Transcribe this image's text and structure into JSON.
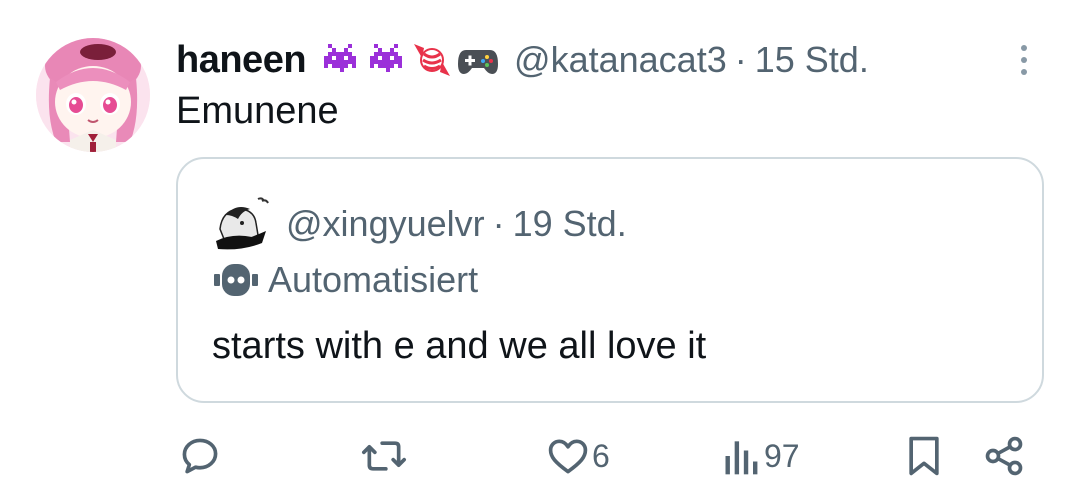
{
  "post": {
    "author": {
      "display_name": "haneen",
      "emoji_icons": [
        "purple-invader-icon",
        "purple-invader-icon",
        "candy-icon",
        "game-controller-icon"
      ],
      "handle": "@katanacat3",
      "separator": "·",
      "timestamp": "15 Std."
    },
    "text": "Emunene",
    "quote": {
      "handle": "@xingyuelvr",
      "separator": "·",
      "timestamp": "19 Std.",
      "automated_label": "Automatisiert",
      "text": "starts with e and we all love it"
    },
    "actions": {
      "reply": "",
      "repost": "",
      "like": "6",
      "views": "97"
    }
  },
  "colors": {
    "text_primary": "#0f1419",
    "text_secondary": "#536471",
    "border": "#cfd9de",
    "invader": "#9b30d9",
    "candy": "#e8324a"
  }
}
